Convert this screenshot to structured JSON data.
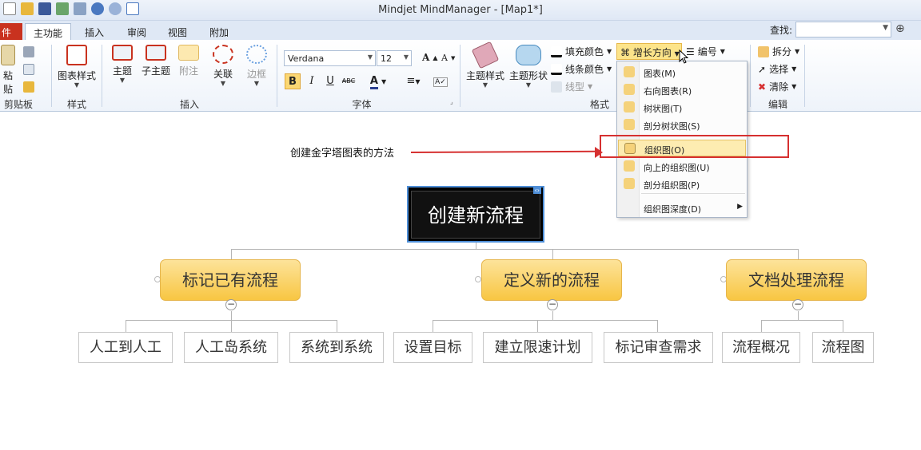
{
  "window": {
    "title": "Mindjet MindManager - [Map1*]"
  },
  "tabs": {
    "file": "件",
    "home": "主功能",
    "insert": "插入",
    "review": "审阅",
    "view": "视图",
    "addins": "附加"
  },
  "search": {
    "label": "查找:",
    "value": ""
  },
  "ribbon": {
    "clipboard": {
      "paste": "粘贴",
      "label": "剪贴板"
    },
    "style": {
      "map_style": "图表样式",
      "label": "样式"
    },
    "insert": {
      "topic": "主题",
      "subtopic": "子主题",
      "callout": "附注",
      "relationship": "关联",
      "boundary": "边框",
      "label": "插入"
    },
    "font": {
      "family": "Verdana",
      "size": "12",
      "label": "字体",
      "bold": "B",
      "italic": "I",
      "underline": "U",
      "strike": "ABC"
    },
    "format": {
      "topic_style": "主题样式",
      "topic_shape": "主题形状",
      "fill_color": "填充颜色",
      "line_color": "线条颜色",
      "line_style": "线型",
      "growth": "增长方向",
      "numbering": "编号",
      "label": "格式"
    },
    "edit": {
      "split": "拆分",
      "select": "选择",
      "clear": "清除",
      "label": "编辑"
    }
  },
  "growth_menu": {
    "items": [
      {
        "label": "图表(M)",
        "selected": false
      },
      {
        "label": "右向图表(R)",
        "selected": false
      },
      {
        "label": "树状图(T)",
        "selected": false
      },
      {
        "label": "剖分树状图(S)",
        "selected": false
      },
      {
        "label": "组织图(O)",
        "selected": true
      },
      {
        "label": "向上的组织图(U)",
        "selected": false
      },
      {
        "label": "剖分组织图(P)",
        "selected": false
      }
    ],
    "depth": "组织图深度(D)"
  },
  "annotation": {
    "text": "创建金字塔图表的方法",
    "color": "#d63030"
  },
  "map": {
    "central": "创建新流程",
    "branches": [
      {
        "label": "标记已有流程",
        "children": [
          "人工到人工",
          "人工岛系统",
          "系统到系统"
        ]
      },
      {
        "label": "定义新的流程",
        "children": [
          "设置目标",
          "建立限速计划",
          "标记审查需求"
        ]
      },
      {
        "label": "文档处理流程",
        "children": [
          "流程概况",
          "流程图"
        ]
      }
    ]
  },
  "colors": {
    "topic_fill": "#f8c642",
    "central_fill": "#000000",
    "highlight": "#fce48a",
    "file_tab": "#c9321f"
  }
}
